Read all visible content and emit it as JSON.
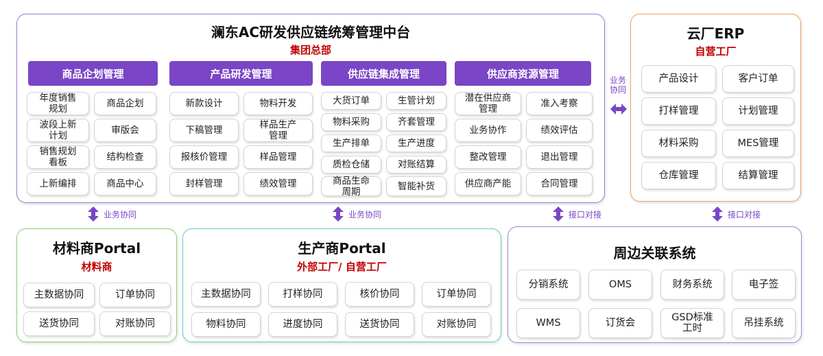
{
  "main": {
    "title": "澜东AC研发供应链统筹管理中台",
    "subtitle": "集团总部",
    "columns": [
      {
        "header": "商品企划管理",
        "items": [
          "年度销售\n规划",
          "商品企划",
          "波段上新\n计划",
          "审版会",
          "销售规划\n看板",
          "结构检查",
          "上新编排",
          "商品中心"
        ]
      },
      {
        "header": "产品研发管理",
        "items": [
          "新款设计",
          "物料开发",
          "下稿管理",
          "样品生产\n管理",
          "报核价管理",
          "样品管理",
          "封样管理",
          "绩效管理"
        ]
      },
      {
        "header": "供应链集成管理",
        "items": [
          "大货订单",
          "生管计划",
          "物料采购",
          "齐套管理",
          "生产排单",
          "生产进度",
          "质检仓储",
          "对账结算",
          "商品生命\n周期",
          "智能补货"
        ]
      },
      {
        "header": "供应商资源管理",
        "items": [
          "潜在供应商\n管理",
          "准入考察",
          "业务协作",
          "绩效评估",
          "整改管理",
          "退出管理",
          "供应商产能",
          "合同管理"
        ]
      }
    ]
  },
  "erp": {
    "title": "云厂ERP",
    "subtitle": "自营工厂",
    "items": [
      "产品设计",
      "客户订单",
      "打样管理",
      "计划管理",
      "材料采购",
      "MES管理",
      "仓库管理",
      "结算管理"
    ]
  },
  "material_portal": {
    "title": "材料商Portal",
    "subtitle": "材料商",
    "items": [
      "主数据协同",
      "订单协同",
      "送货协同",
      "对账协同"
    ]
  },
  "producer_portal": {
    "title": "生产商Portal",
    "subtitle": "外部工厂/ 自营工厂",
    "items": [
      "主数据协同",
      "打样协同",
      "核价协同",
      "订单协同",
      "物料协同",
      "进度协同",
      "送货协同",
      "对账协同"
    ]
  },
  "peripheral": {
    "title": "周边关联系统",
    "items": [
      "分销系统",
      "OMS",
      "财务系统",
      "电子签",
      "WMS",
      "订货会",
      "GSD标准\n工时",
      "吊挂系统"
    ]
  },
  "connectors": {
    "side": "业务\n协同",
    "c1": "业务协同",
    "c2": "业务协同",
    "c3": "接口对接",
    "c4": "接口对接"
  },
  "colors": {
    "accent": "#7a45c6",
    "subtitle_red": "#c00000",
    "main_border": "#9b79d6",
    "erp_border": "#f2a155",
    "material_border": "#8fcf6e",
    "producer_border": "#66c9c9",
    "peripheral_border": "#8f8fd9"
  }
}
